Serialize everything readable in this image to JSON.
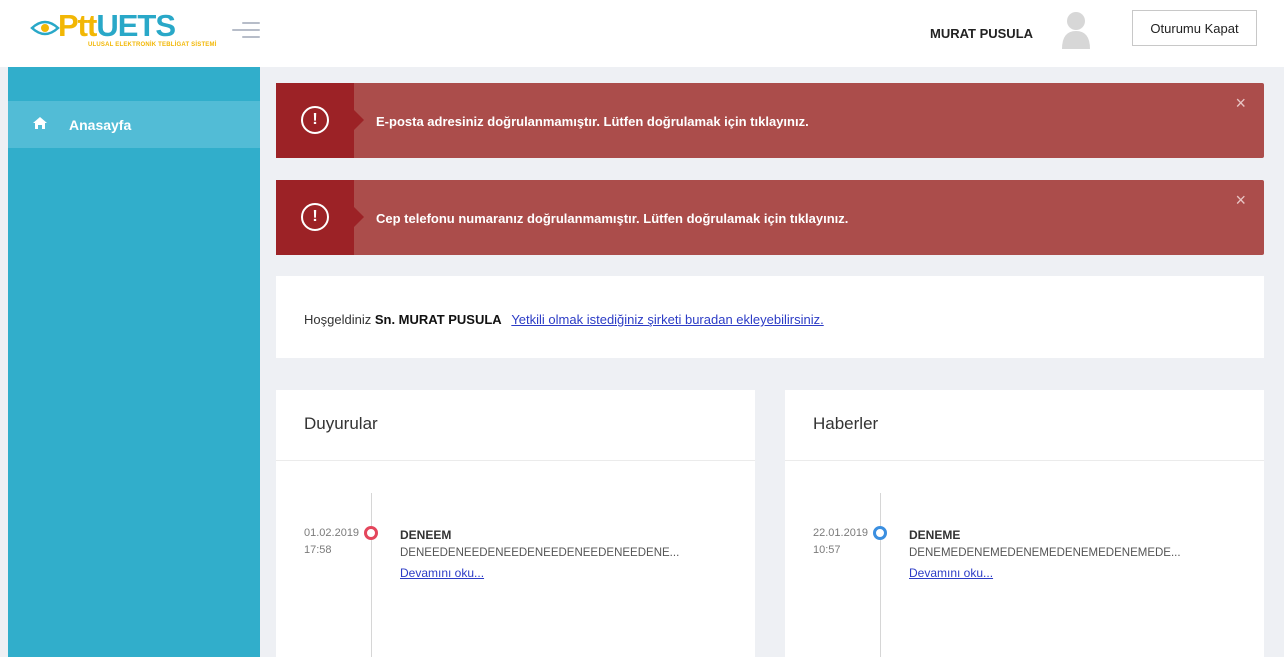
{
  "header": {
    "logo_text_ptt": "Ptt",
    "logo_text_uets": "UETS",
    "logo_subtitle": "ULUSAL ELEKTRONİK TEBLİGAT SİSTEMİ",
    "username": "MURAT PUSULA",
    "logout_label": "Oturumu Kapat"
  },
  "sidebar": {
    "items": [
      {
        "label": "Anasayfa",
        "icon": "home-icon"
      }
    ]
  },
  "alerts": [
    {
      "icon": "!",
      "message": "E-posta adresiniz doğrulanmamıştır. Lütfen doğrulamak için tıklayınız.",
      "close": "×"
    },
    {
      "icon": "!",
      "message": "Cep telefonu numaranız doğrulanmamıştır. Lütfen doğrulamak için tıklayınız.",
      "close": "×"
    }
  ],
  "welcome": {
    "greeting": "Hoşgeldiniz",
    "name": "Sn. MURAT PUSULA",
    "link": "Yetkili olmak istediğiniz şirketi buradan ekleyebilirsiniz."
  },
  "announcements": {
    "title": "Duyurular",
    "items": [
      {
        "date": "01.02.2019",
        "time": "17:58",
        "title": "DENEEM",
        "body": "DENEEDENEEDENEEDENEEDENEEDENEEDENE...",
        "more": "Devamını oku..."
      }
    ]
  },
  "news": {
    "title": "Haberler",
    "items": [
      {
        "date": "22.01.2019",
        "time": "10:57",
        "title": "DENEME",
        "body": "DENEMEDENEMEDENEMEDENEMEDENEMEDE...",
        "more": "Devamını oku..."
      }
    ]
  },
  "colors": {
    "sidebar": "#31aecb",
    "alert": "#ab4d4b",
    "alert_icon": "#9c2226",
    "announcement_dot": "#e4465c",
    "news_dot": "#3b8fe0",
    "link": "#2c3cc6"
  }
}
